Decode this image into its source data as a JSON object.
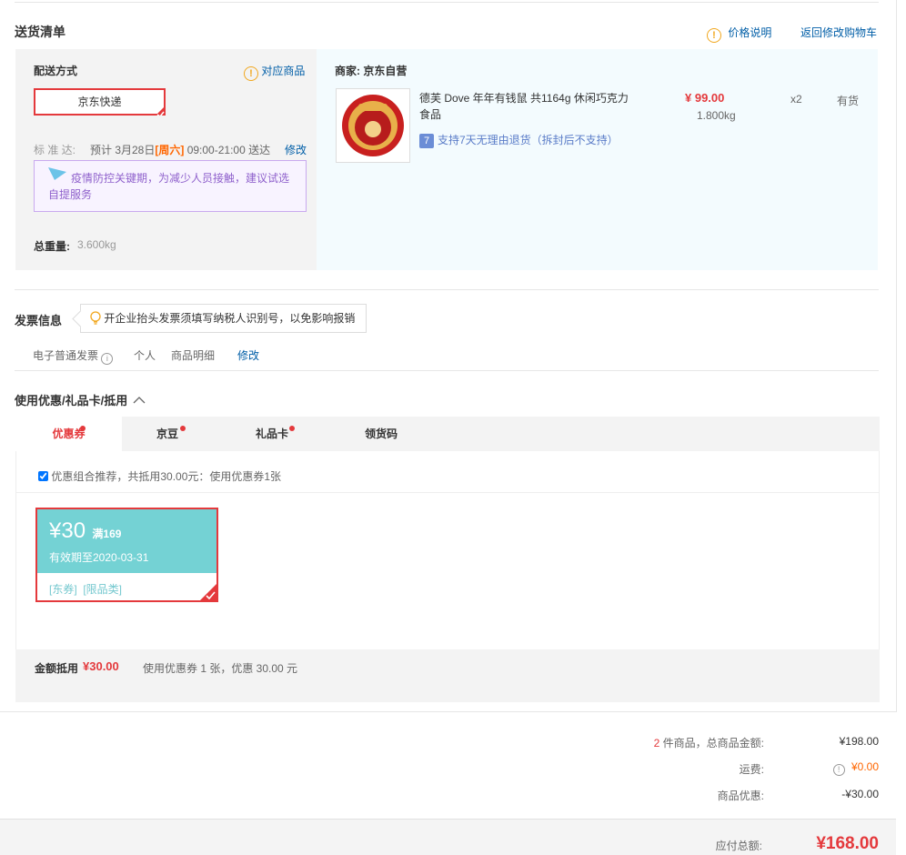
{
  "shipping": {
    "title": "送货清单",
    "price_note": "价格说明",
    "back_link": "返回修改购物车",
    "method_label": "配送方式",
    "corresponding": "对应商品",
    "method": "京东快递",
    "standard_label": "标 准 达:",
    "estimate_prefix": "预计 3月28日",
    "weekday": "[周六]",
    "estimate_time": "09:00-21:00 送达",
    "modify": "修改",
    "notice": "疫情防控关键期，为减少人员接触，建议试选自提服务",
    "weight_label": "总重量:",
    "weight_value": "3.600kg"
  },
  "seller": {
    "label": "商家:",
    "name": "京东自营"
  },
  "product": {
    "name": "德芙 Dove 年年有钱鼠 共1164g 休闲巧克力食品",
    "price": "¥ 99.00",
    "weight": "1.800kg",
    "qty": "x2",
    "stock": "有货",
    "return_badge": "7",
    "return_text": "支持7天无理由退货（拆封后不支持）"
  },
  "invoice": {
    "title": "发票信息",
    "tip": "开企业抬头发票须填写纳税人识别号，以免影响报销",
    "type": "电子普通发票",
    "info_icon": "i",
    "title_type": "个人",
    "content": "商品明细",
    "modify": "修改"
  },
  "discount": {
    "title": "使用优惠/礼品卡/抵用",
    "tabs": [
      {
        "label": "优惠券"
      },
      {
        "label": "京豆"
      },
      {
        "label": "礼品卡"
      },
      {
        "label": "领货码"
      }
    ],
    "combo_text": "优惠组合推荐，共抵用30.00元：使用优惠券1张",
    "coupon": {
      "amount": "¥30",
      "condition": "满169",
      "expiry": "有效期至2020-03-31",
      "tags": "[东券]  [限品类]"
    },
    "sum_label": "金额抵用",
    "sum_value": "¥30.00",
    "sum_detail": "使用优惠券 1 张，优惠 30.00 元"
  },
  "totals": {
    "count": "2",
    "count_label": "件商品，总商品金额:",
    "goods_total": "¥198.00",
    "freight_label": "运费:",
    "freight_icon": "!",
    "freight": "¥0.00",
    "discount_label": "商品优惠:",
    "discount": "-¥30.00",
    "payable_label": "应付总额:",
    "payable": "¥168.00"
  }
}
